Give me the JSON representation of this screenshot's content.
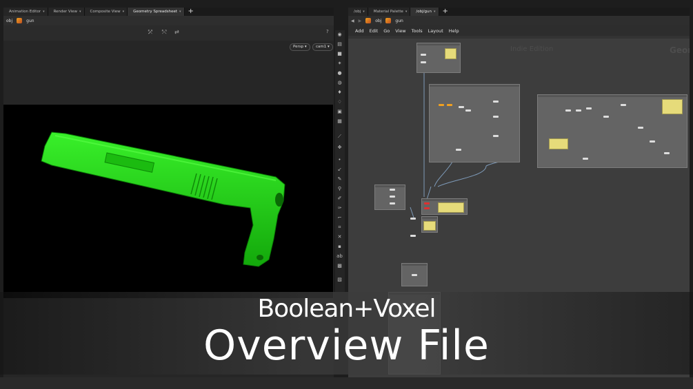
{
  "left_tabs": [
    "Animation Editor",
    "Render View",
    "Composite View",
    "Geometry Spreadsheet"
  ],
  "right_tabs": [
    "/obj",
    "Material Palette",
    "/obj/gun"
  ],
  "left_path": {
    "root": "obj",
    "node": "gun"
  },
  "right_path": {
    "root": "obj",
    "node": "gun"
  },
  "viewport": {
    "camera_mode": "Persp",
    "camera": "cam1"
  },
  "menu": [
    "Add",
    "Edit",
    "Go",
    "View",
    "Tools",
    "Layout",
    "Help"
  ],
  "watermark": {
    "edition": "Indie Edition",
    "context": "Geom"
  },
  "title": {
    "line1": "Boolean+Voxel",
    "line2": "Overview File"
  },
  "colors": {
    "model_green": "#22d414",
    "note_yellow": "#e6db7a",
    "flag_orange": "#f0a020",
    "flag_red": "#e03030"
  }
}
